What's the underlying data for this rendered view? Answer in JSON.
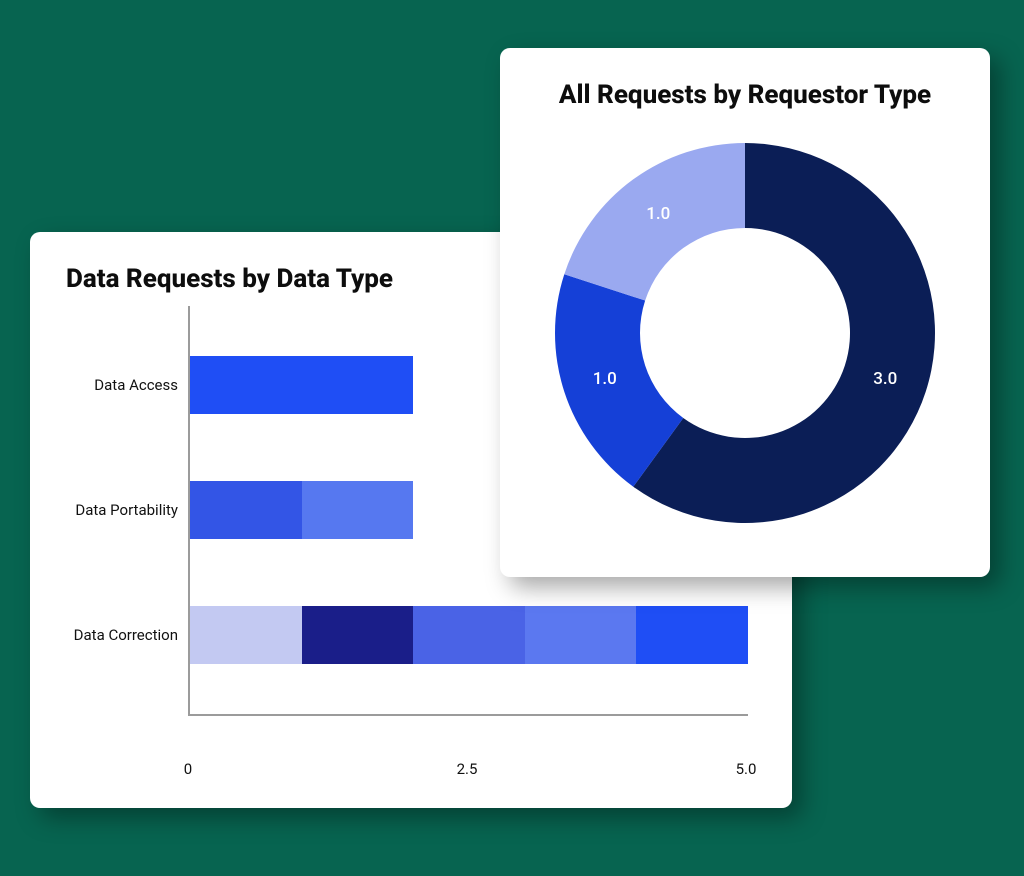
{
  "bar_card": {
    "title": "Data Requests by Data Type"
  },
  "donut_card": {
    "title": "All Requests by Requestor Type"
  },
  "chart_data": [
    {
      "id": "bar",
      "type": "bar",
      "orientation": "horizontal",
      "stacked": true,
      "title": "Data Requests by Data Type",
      "xlabel": "",
      "ylabel": "",
      "xlim": [
        0,
        5.0
      ],
      "x_ticks": [
        0,
        2.5,
        5.0
      ],
      "categories": [
        "Data Access",
        "Data Portability",
        "Data Correction"
      ],
      "rows": [
        {
          "label": "Data Access",
          "segments": [
            {
              "value": 2.0,
              "color": "#1f4ef5"
            }
          ]
        },
        {
          "label": "Data Portability",
          "segments": [
            {
              "value": 1.0,
              "color": "#3355e6"
            },
            {
              "value": 1.0,
              "color": "#5678f0"
            }
          ]
        },
        {
          "label": "Data Correction",
          "segments": [
            {
              "value": 1.0,
              "color": "#c3c9f2"
            },
            {
              "value": 1.0,
              "color": "#1a1e89"
            },
            {
              "value": 1.0,
              "color": "#4a63e6"
            },
            {
              "value": 1.0,
              "color": "#5b78f0"
            },
            {
              "value": 1.0,
              "color": "#1f4ef5"
            }
          ]
        }
      ]
    },
    {
      "id": "donut",
      "type": "pie",
      "variant": "donut",
      "title": "All Requests by Requestor Type",
      "slices": [
        {
          "label": "3.0",
          "value": 3.0,
          "color": "#0b1e56"
        },
        {
          "label": "1.0",
          "value": 1.0,
          "color": "#1540d7"
        },
        {
          "label": "1.0",
          "value": 1.0,
          "color": "#9aa9f0"
        }
      ]
    }
  ]
}
